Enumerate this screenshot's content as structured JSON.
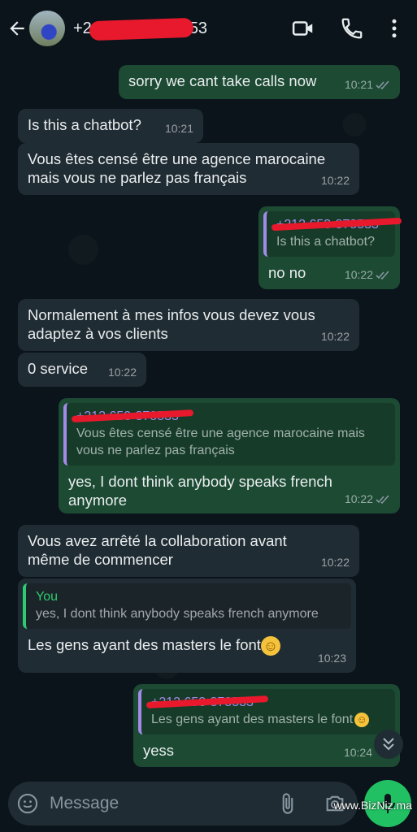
{
  "header": {
    "contact_visible": "+2",
    "contact_end": "53",
    "icons": [
      "back-arrow-icon",
      "video-call-icon",
      "phone-icon",
      "more-vertical-icon"
    ]
  },
  "messages": [
    {
      "dir": "out",
      "text": "sorry we cant take calls now",
      "time": "10:21"
    },
    {
      "dir": "in",
      "text": "Is this a chatbot?",
      "time": "10:21"
    },
    {
      "dir": "in",
      "text": "Vous êtes censé être une agence marocaine mais vous ne parlez pas français",
      "time": "10:22"
    },
    {
      "dir": "out",
      "quote_name": "+212 653-878533",
      "quote_text": "Is this a chatbot?",
      "text": "no no",
      "time": "10:22"
    },
    {
      "dir": "in",
      "text": "Normalement à mes infos vous devez vous adaptez à vos clients",
      "time": "10:22"
    },
    {
      "dir": "in",
      "text": "0 service",
      "time": "10:22"
    },
    {
      "dir": "out",
      "quote_name": "+212 653-878533",
      "quote_text": "Vous êtes censé être une agence marocaine mais vous ne parlez pas français",
      "text": "yes, I dont think anybody speaks french anymore",
      "time": "10:22"
    },
    {
      "dir": "in",
      "text": "Vous avez arrêté la collaboration avant même de commencer",
      "time": "10:22"
    },
    {
      "dir": "in",
      "quote_name": "You",
      "quote_text": "yes, I dont think anybody speaks french anymore",
      "text": "Les gens ayant des masters le font",
      "emoji": "☺",
      "time": "10:23"
    },
    {
      "dir": "out",
      "quote_name": "+212 653-878533",
      "quote_text": "Les gens ayant des masters le font",
      "quote_emoji": "☺",
      "text": "yess",
      "time": "10:24"
    }
  ],
  "composer": {
    "placeholder": "Message",
    "icons": [
      "emoji-icon",
      "attach-icon",
      "camera-icon",
      "mic-icon"
    ]
  },
  "watermark": "www.BizNiz.ma",
  "colors": {
    "outgoing": "#1c4a33",
    "incoming": "#202c33",
    "accent": "#21c063",
    "read_ticks": "#8696a0"
  }
}
